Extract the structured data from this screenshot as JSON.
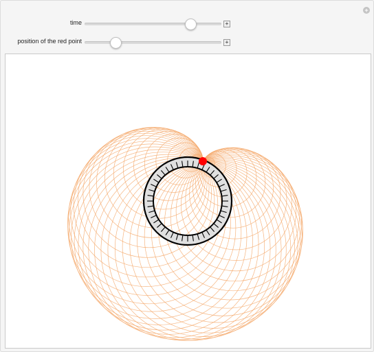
{
  "controls": {
    "time": {
      "label": "time",
      "value_fraction": 0.775
    },
    "position": {
      "label": "position of the red point",
      "value_fraction": 0.225
    },
    "plus_symbol": "+"
  },
  "corner_button_symbol": "+",
  "figure": {
    "envelope_color": "#f4a86a",
    "ring_fill": "#e0e0e0",
    "ring_stroke": "#000000",
    "red_point_color": "#ff0000",
    "tick_count": 44,
    "circle_count": 48
  }
}
